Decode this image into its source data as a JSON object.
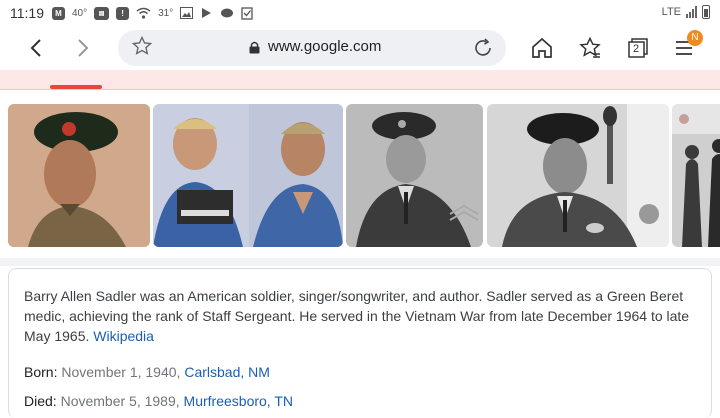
{
  "status_bar": {
    "time": "11:19",
    "temperature_1": "40°",
    "temperature_2": "31°",
    "network": "LTE"
  },
  "browser": {
    "url": "www.google.com",
    "menu_badge": "N",
    "tab_count": "2"
  },
  "images": [
    {
      "name": "soldier-green-beret-photo"
    },
    {
      "name": "mugshot-photo"
    },
    {
      "name": "air-force-uniform-photo"
    },
    {
      "name": "beret-singing-photo"
    },
    {
      "name": "silhouette-photo"
    }
  ],
  "knowledge_panel": {
    "description": "Barry Allen Sadler was an American soldier, singer/songwriter, and author. Sadler served as a Green Beret medic, achieving the rank of Staff Sergeant. He served in the Vietnam War from late December 1964 to late May 1965. ",
    "source_link": "Wikipedia",
    "born": {
      "label": "Born:",
      "value": "November 1, 1940, ",
      "place": "Carlsbad, NM"
    },
    "died": {
      "label": "Died:",
      "value": "November 5, 1989, ",
      "place": "Murfreesboro, TN"
    }
  }
}
